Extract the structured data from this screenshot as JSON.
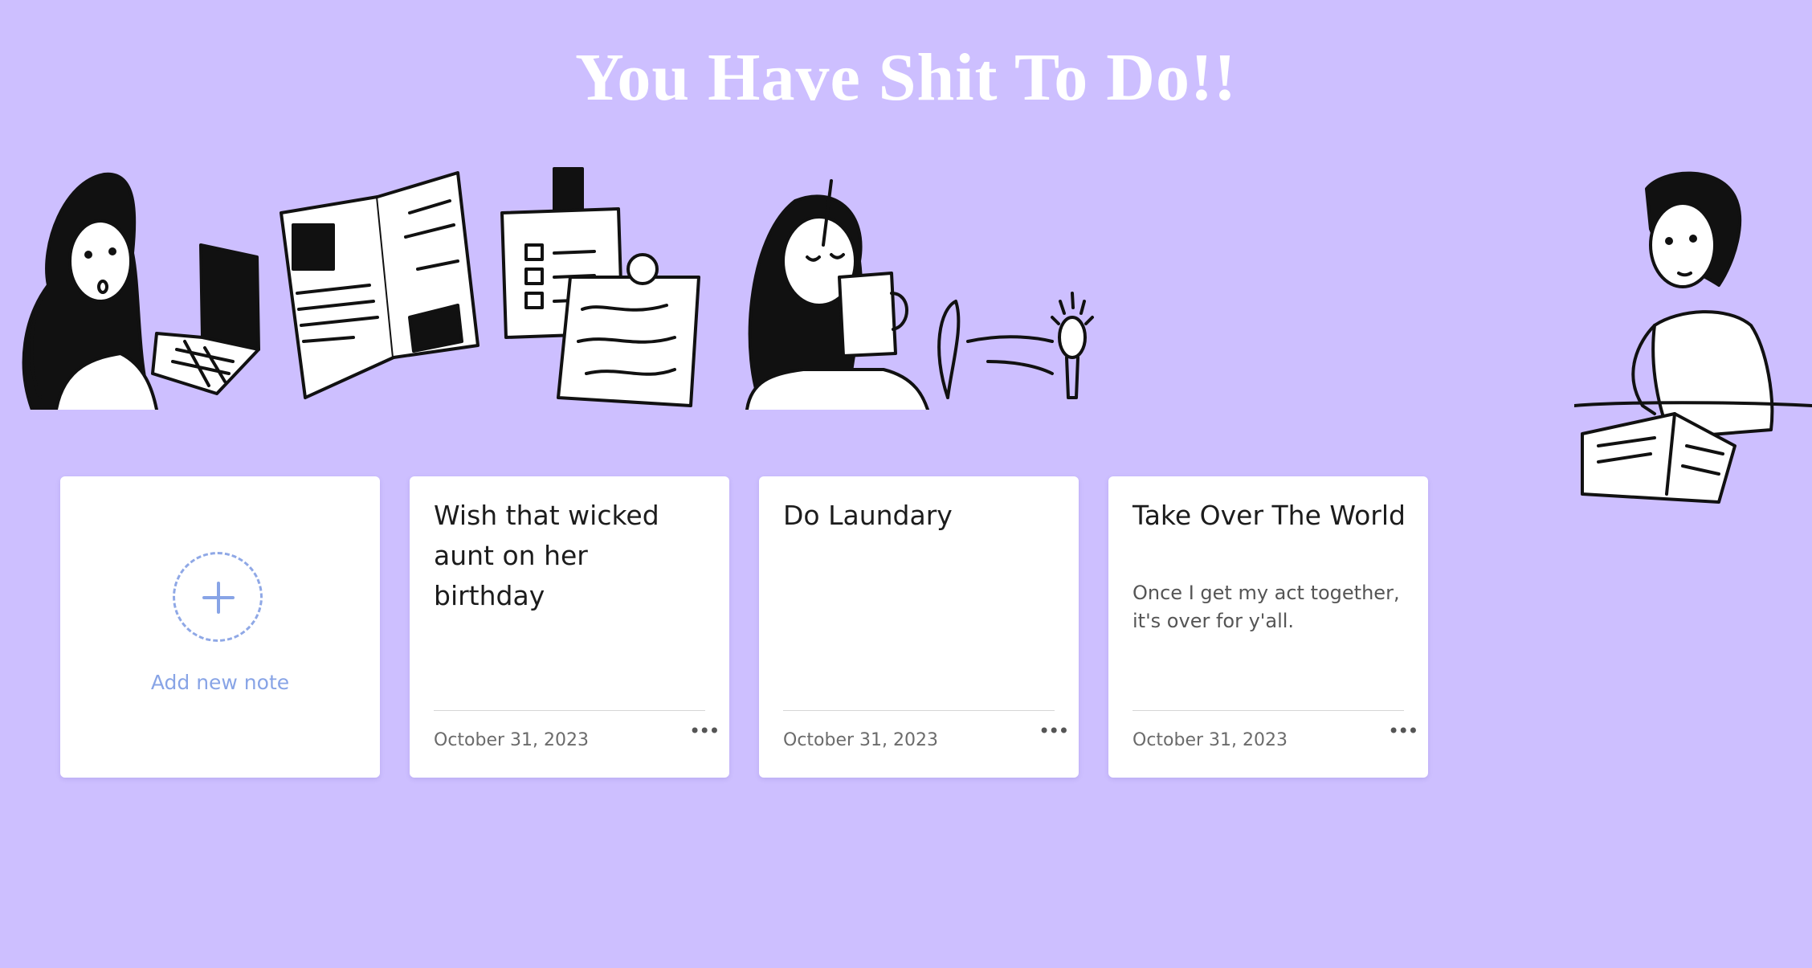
{
  "header": {
    "title": "You Have Shit To Do!!"
  },
  "add_note": {
    "label": "Add new note",
    "icon": "plus-icon"
  },
  "notes": [
    {
      "title": "Wish that wicked aunt on her birthday",
      "description": "",
      "date": "October 31, 2023",
      "menu_icon": "more-dots-icon"
    },
    {
      "title": "Do Laundary",
      "description": "",
      "date": "October 31, 2023",
      "menu_icon": "more-dots-icon"
    },
    {
      "title": "Take Over The World",
      "description": "Once I get my act together, it's over for y'all.",
      "date": "October 31, 2023",
      "menu_icon": "more-dots-icon"
    }
  ],
  "colors": {
    "background": "#cdbfff",
    "accent": "#88a4e6",
    "card": "#ffffff"
  }
}
